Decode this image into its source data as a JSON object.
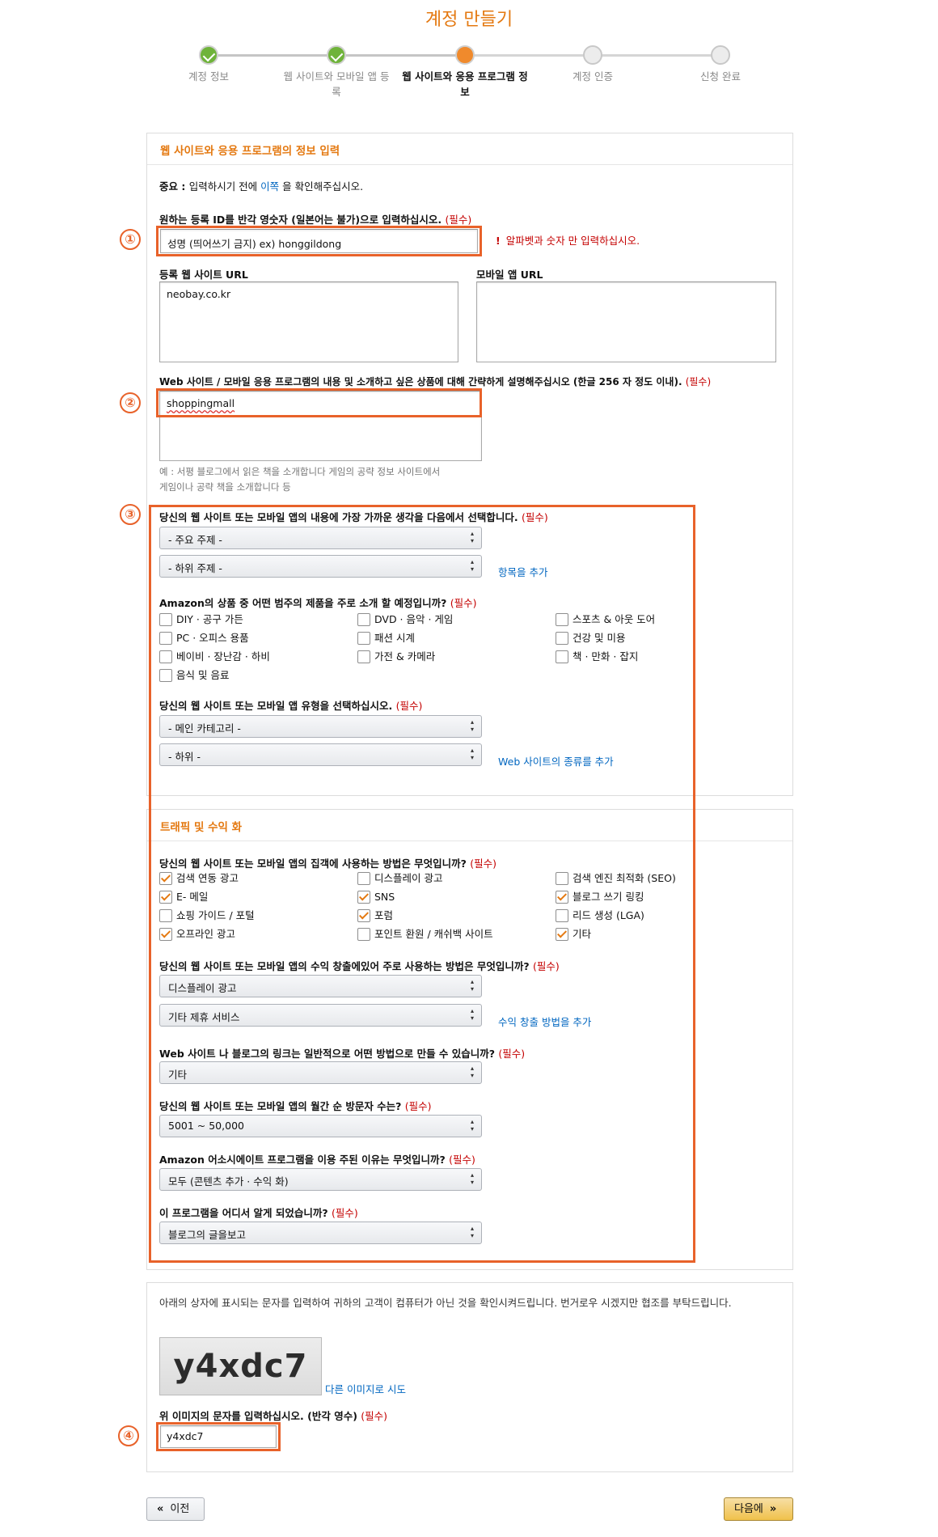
{
  "page_title": "계정 만들기",
  "steps": [
    {
      "label": "계정 정보",
      "state": "done"
    },
    {
      "label": "웹 사이트와 모바일 앱 등록",
      "state": "done"
    },
    {
      "label": "웹 사이트와 응용 프로그램 정보",
      "state": "current"
    },
    {
      "label": "계정 인증",
      "state": "pending"
    },
    {
      "label": "신청 완료",
      "state": "pending"
    }
  ],
  "section1": {
    "header": "웹 사이트와 응용 프로그램의 정보 입력",
    "important_prefix": "중요 : ",
    "important_text_a": "입력하시기 전에 ",
    "important_link": "이쪽",
    "important_text_b": " 을 확인해주십시오.",
    "store_id_label": "원하는 등록 ID를 반각 영숫자 (일본어는 불가)으로 입력하십시오.",
    "store_id_value": "성명 (띄어쓰기 금지) ex) honggildong",
    "store_id_error": "알파벳과 숫자 만 입력하십시오.",
    "website_url_label": "등록 웹 사이트 URL",
    "website_url_value": "neobay.co.kr",
    "mobile_url_label": "모바일 앱 URL",
    "mobile_url_value": "",
    "description_label": "Web 사이트 / 모바일 응용 프로그램의 내용 및 소개하고 싶은 상품에 대해 간략하게 설명해주십시오 (한글 256 자 정도 이내).",
    "description_value": "shoppingmall",
    "description_hint_1": "예 : 서평 블로그에서 읽은 책을 소개합니다 게임의 공략 정보 사이트에서",
    "description_hint_2": "게임이나 공략 책을 소개합니다 등",
    "topic_label": "당신의 웹 사이트 또는 모바일 앱의 내용에 가장 가까운 생각을 다음에서 선택합니다.",
    "topic_main": "- 주요 주제 -",
    "topic_sub": "- 하위 주제 -",
    "topic_add_link": "항목을 추가",
    "product_label": "Amazon의 상품 중 어떤 범주의 제품을 주로 소개 할 예정입니까?",
    "product_categories": [
      {
        "label": "DIY · 공구 가든",
        "checked": false
      },
      {
        "label": "DVD · 음악 · 게임",
        "checked": false
      },
      {
        "label": "스포츠 & 아웃 도어",
        "checked": false
      },
      {
        "label": "PC · 오피스 용품",
        "checked": false
      },
      {
        "label": "패션 시계",
        "checked": false
      },
      {
        "label": "건강 및 미용",
        "checked": false
      },
      {
        "label": "베이비 · 장난감 · 하비",
        "checked": false
      },
      {
        "label": "가전 & 카메라",
        "checked": false
      },
      {
        "label": "책 · 만화 · 잡지",
        "checked": false
      },
      {
        "label": "음식 및 음료",
        "checked": false
      }
    ],
    "type_label": "당신의 웹 사이트 또는 모바일 앱 유형을 선택하십시오.",
    "type_main": "- 메인 카테고리 -",
    "type_sub": "- 하위 -",
    "type_add_link": "Web 사이트의 종류를 추가"
  },
  "required_mark": "(필수)",
  "section2": {
    "header": "트래픽 및 수익 화",
    "traffic_label": "당신의 웹 사이트 또는 모바일 앱의 집객에 사용하는 방법은 무엇입니까?",
    "traffic_methods": [
      {
        "label": "검색 연동 광고",
        "checked": true
      },
      {
        "label": "디스플레이 광고",
        "checked": false
      },
      {
        "label": "검색 엔진 최적화 (SEO)",
        "checked": false
      },
      {
        "label": "E- 메일",
        "checked": true
      },
      {
        "label": "SNS",
        "checked": true
      },
      {
        "label": "블로그 쓰기 링킹",
        "checked": true
      },
      {
        "label": "쇼핑 가이드 / 포털",
        "checked": false
      },
      {
        "label": "포럼",
        "checked": true
      },
      {
        "label": "리드 생성 (LGA)",
        "checked": false
      },
      {
        "label": "오프라인 광고",
        "checked": true
      },
      {
        "label": "포인트 환원 / 캐쉬백 사이트",
        "checked": false
      },
      {
        "label": "기타",
        "checked": true
      }
    ],
    "monetize_label": "당신의 웹 사이트 또는 모바일 앱의 수익 창출에있어 주로 사용하는 방법은 무엇입니까?",
    "monetize_1": "디스플레이 광고",
    "monetize_2": "기타 제휴 서비스",
    "monetize_add_link": "수익 창출 방법을 추가",
    "link_label": "Web 사이트 나 블로그의 링크는 일반적으로 어떤 방법으로 만들 수 있습니까?",
    "link_value": "기타",
    "visitors_label": "당신의 웹 사이트 또는 모바일 앱의 월간 순 방문자 수는?",
    "visitors_value": "5001 ~ 50,000",
    "reason_label": "Amazon 어소시에이트 프로그램을 이용 주된 이유는 무엇입니까?",
    "reason_value": "모두 (콘텐츠 추가 · 수익 화)",
    "source_label": "이 프로그램을 어디서 알게 되었습니까?",
    "source_value": "블로그의 글을보고"
  },
  "captcha": {
    "description": "아래의 상자에 표시되는 문자를 입력하여 귀하의 고객이 컴퓨터가 아닌 것을 확인시켜드립니다. 번거로우 시겠지만 협조를 부탁드립니다.",
    "image_text": "y4xdc7",
    "retry_link": "다른 이미지로 시도",
    "input_label": "위 이미지의 문자를 입력하십시오. (반각 영수)",
    "input_value": "y4xdc7"
  },
  "annotations": [
    "①",
    "②",
    "③",
    "④"
  ],
  "buttons": {
    "prev": "이전",
    "next": "다음에"
  },
  "colors": {
    "accent": "#e47911",
    "highlight": "#e8622a",
    "required": "#c40000",
    "link": "#0066c0"
  }
}
